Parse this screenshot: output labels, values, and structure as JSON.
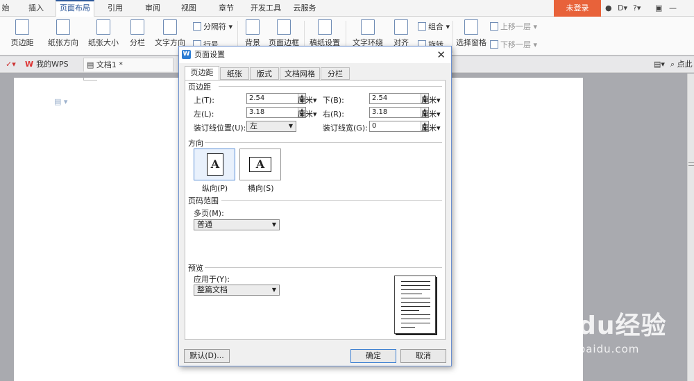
{
  "ribbon_tabs": [
    "始",
    "插入",
    "页面布局",
    "引用",
    "审阅",
    "视图",
    "章节",
    "开发工具",
    "云服务"
  ],
  "login_label": "未登录",
  "help_label": "?",
  "ribbon": {
    "margins": "页边距",
    "orientation": "纸张方向",
    "size": "纸张大小",
    "columns": "分栏",
    "text_direction": "文字方向",
    "separator": "分隔符",
    "line_number": "行号",
    "background": "背景",
    "page_border": "页面边框",
    "manuscript": "稿纸设置",
    "text_wrap": "文字环绕",
    "align": "对齐",
    "group": "组合",
    "rotate": "旋转",
    "selection_pane": "选择窗格",
    "bring_forward": "上移一层",
    "send_backward": "下移一层"
  },
  "doc_tabs": {
    "wps": "我的WPS",
    "doc": "文档1 *",
    "search": "点此"
  },
  "dialog": {
    "title": "页面设置",
    "tabs": [
      "页边距",
      "纸张",
      "版式",
      "文档网格",
      "分栏"
    ],
    "margins_group": "页边距",
    "top_label": "上(T):",
    "top_value": "2.54",
    "bottom_label": "下(B):",
    "bottom_value": "2.54",
    "left_label": "左(L):",
    "left_value": "3.18",
    "right_label": "右(R):",
    "right_value": "3.18",
    "unit": "厘米",
    "gutter_pos_label": "装订线位置(U):",
    "gutter_pos_value": "左",
    "gutter_width_label": "装订线宽(G):",
    "gutter_width_value": "0",
    "orientation_group": "方向",
    "portrait": "纵向(P)",
    "landscape": "横向(S)",
    "page_range_group": "页码范围",
    "multi_page_label": "多页(M):",
    "multi_page_value": "普通",
    "preview_group": "预览",
    "apply_to_label": "应用于(Y):",
    "apply_to_value": "整篇文档",
    "default_btn": "默认(D)...",
    "ok_btn": "确定",
    "cancel_btn": "取消"
  },
  "watermark": {
    "brand": "Baidu经验",
    "url": "jingyan.baidu.com"
  }
}
